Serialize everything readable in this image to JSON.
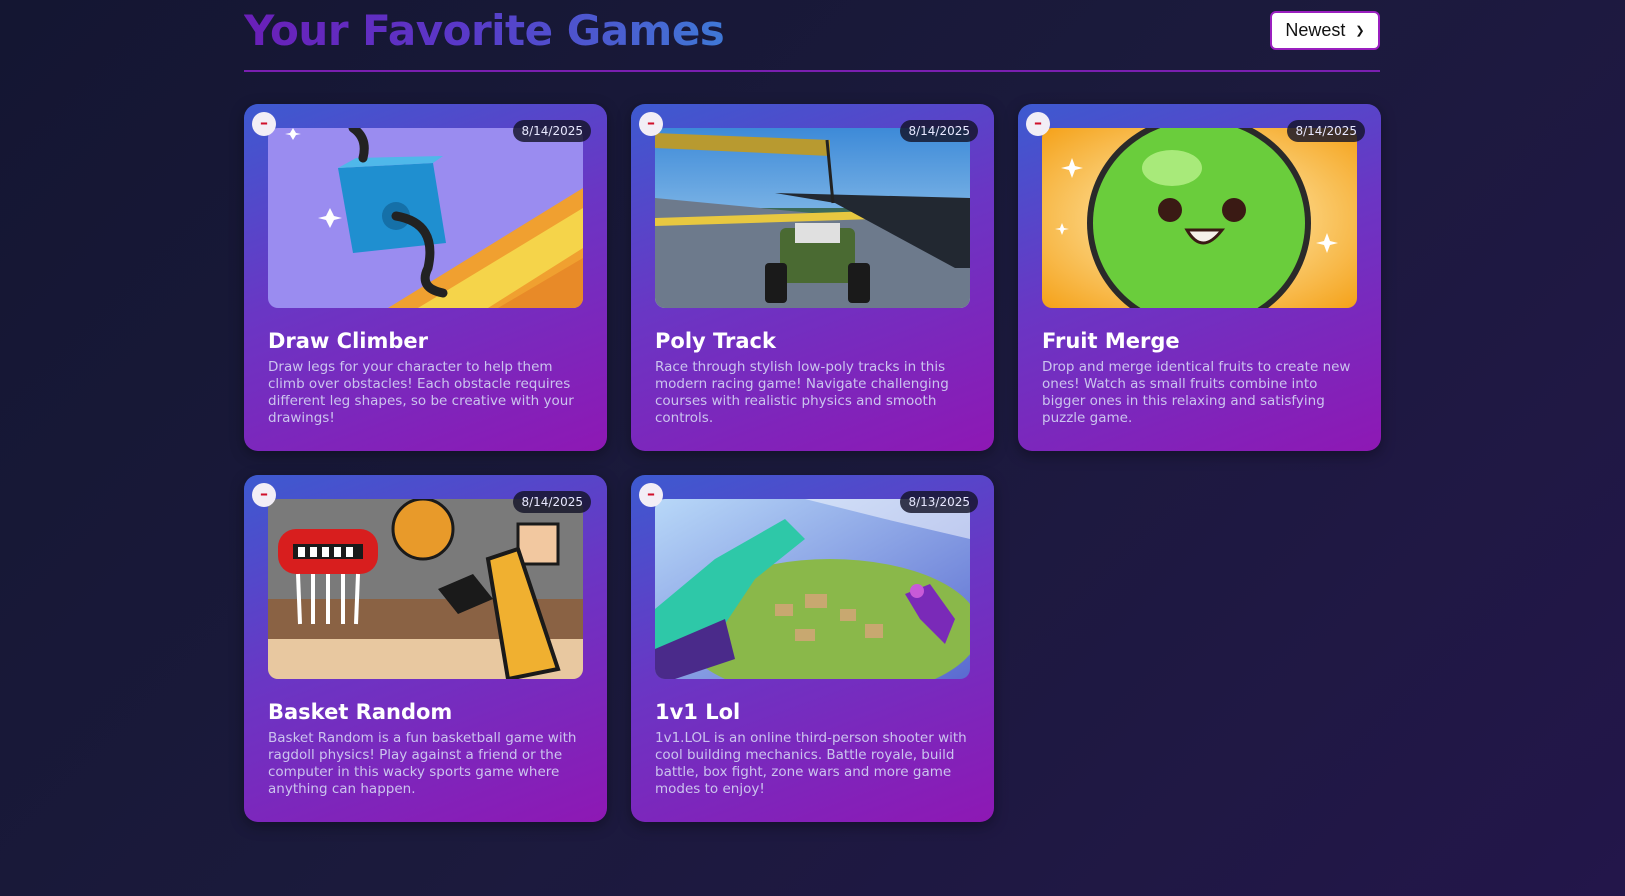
{
  "header": {
    "title": "Your Favorite Games",
    "sort": {
      "selected": "Newest"
    }
  },
  "games": [
    {
      "title": "Draw Climber",
      "date": "8/14/2025",
      "description": "Draw legs for your character to help them climb over obstacles! Each obstacle requires different leg shapes, so be creative with your drawings!"
    },
    {
      "title": "Poly Track",
      "date": "8/14/2025",
      "description": "Race through stylish low-poly tracks in this modern racing game! Navigate challenging courses with realistic physics and smooth controls."
    },
    {
      "title": "Fruit Merge",
      "date": "8/14/2025",
      "description": "Drop and merge identical fruits to create new ones! Watch as small fruits combine into bigger ones in this relaxing and satisfying puzzle game."
    },
    {
      "title": "Basket Random",
      "date": "8/14/2025",
      "description": "Basket Random is a fun basketball game with ragdoll physics! Play against a friend or the computer in this wacky sports game where anything can happen."
    },
    {
      "title": "1v1 Lol",
      "date": "8/13/2025",
      "description": "1v1.LOL is an online third-person shooter with cool building mechanics. Battle royale, build battle, box fight, zone wars and more game modes to enjoy!"
    }
  ],
  "icons": {
    "remove": "minus-icon",
    "sort": "chevron-down-icon"
  }
}
